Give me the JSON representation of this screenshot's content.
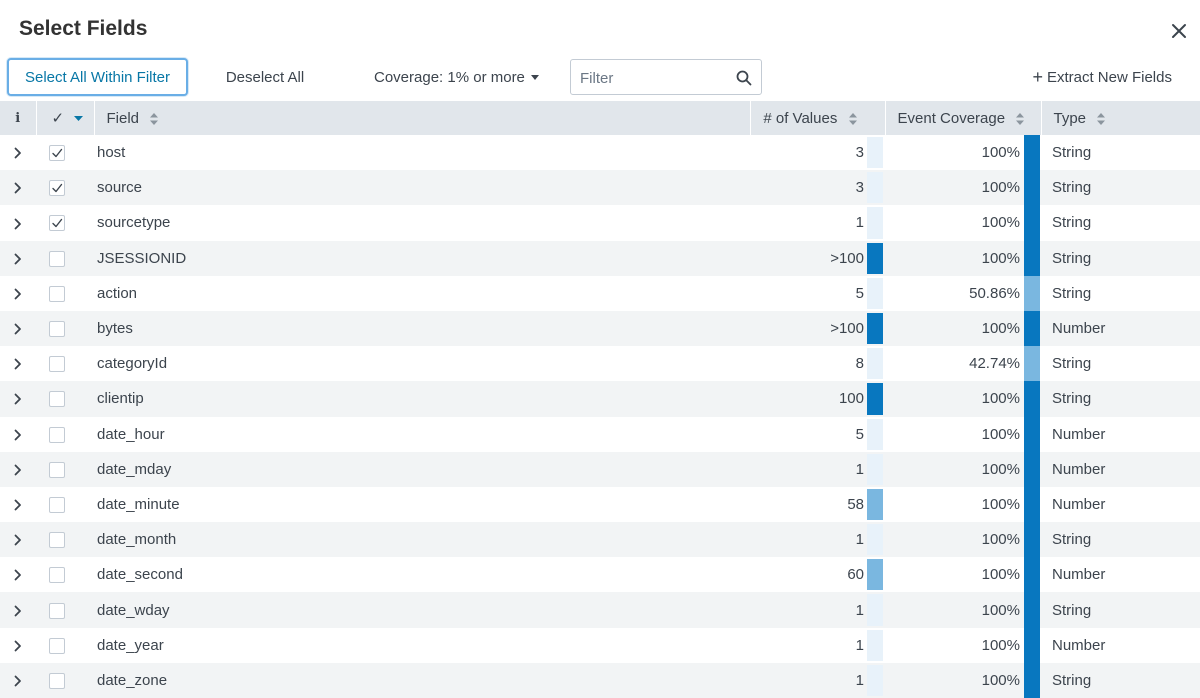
{
  "dialog": {
    "title": "Select Fields",
    "close_icon": "close-icon"
  },
  "toolbar": {
    "select_all_label": "Select All Within Filter",
    "deselect_all_label": "Deselect All",
    "coverage_label": "Coverage: 1% or more",
    "filter_placeholder": "Filter",
    "filter_value": "",
    "extract_label": "Extract New Fields"
  },
  "table": {
    "headers": {
      "info": "i",
      "check": "✓",
      "field": "Field",
      "values": "# of Values",
      "coverage": "Event Coverage",
      "type": "Type"
    },
    "rows": [
      {
        "checked": true,
        "field": "host",
        "values": "3",
        "values_fraction": 0.03,
        "coverage": "100%",
        "coverage_fraction": 1.0,
        "type": "String"
      },
      {
        "checked": true,
        "field": "source",
        "values": "3",
        "values_fraction": 0.03,
        "coverage": "100%",
        "coverage_fraction": 1.0,
        "type": "String"
      },
      {
        "checked": true,
        "field": "sourcetype",
        "values": "1",
        "values_fraction": 0.01,
        "coverage": "100%",
        "coverage_fraction": 1.0,
        "type": "String"
      },
      {
        "checked": false,
        "field": "JSESSIONID",
        "values": ">100",
        "values_fraction": 1.0,
        "coverage": "100%",
        "coverage_fraction": 1.0,
        "type": "String"
      },
      {
        "checked": false,
        "field": "action",
        "values": "5",
        "values_fraction": 0.05,
        "coverage": "50.86%",
        "coverage_fraction": 0.5086,
        "type": "String"
      },
      {
        "checked": false,
        "field": "bytes",
        "values": ">100",
        "values_fraction": 1.0,
        "coverage": "100%",
        "coverage_fraction": 1.0,
        "type": "Number"
      },
      {
        "checked": false,
        "field": "categoryId",
        "values": "8",
        "values_fraction": 0.08,
        "coverage": "42.74%",
        "coverage_fraction": 0.4274,
        "type": "String"
      },
      {
        "checked": false,
        "field": "clientip",
        "values": "100",
        "values_fraction": 1.0,
        "coverage": "100%",
        "coverage_fraction": 1.0,
        "type": "String"
      },
      {
        "checked": false,
        "field": "date_hour",
        "values": "5",
        "values_fraction": 0.05,
        "coverage": "100%",
        "coverage_fraction": 1.0,
        "type": "Number"
      },
      {
        "checked": false,
        "field": "date_mday",
        "values": "1",
        "values_fraction": 0.01,
        "coverage": "100%",
        "coverage_fraction": 1.0,
        "type": "Number"
      },
      {
        "checked": false,
        "field": "date_minute",
        "values": "58",
        "values_fraction": 0.58,
        "coverage": "100%",
        "coverage_fraction": 1.0,
        "type": "Number"
      },
      {
        "checked": false,
        "field": "date_month",
        "values": "1",
        "values_fraction": 0.01,
        "coverage": "100%",
        "coverage_fraction": 1.0,
        "type": "String"
      },
      {
        "checked": false,
        "field": "date_second",
        "values": "60",
        "values_fraction": 0.6,
        "coverage": "100%",
        "coverage_fraction": 1.0,
        "type": "Number"
      },
      {
        "checked": false,
        "field": "date_wday",
        "values": "1",
        "values_fraction": 0.01,
        "coverage": "100%",
        "coverage_fraction": 1.0,
        "type": "String"
      },
      {
        "checked": false,
        "field": "date_year",
        "values": "1",
        "values_fraction": 0.01,
        "coverage": "100%",
        "coverage_fraction": 1.0,
        "type": "Number"
      },
      {
        "checked": false,
        "field": "date_zone",
        "values": "1",
        "values_fraction": 0.01,
        "coverage": "100%",
        "coverage_fraction": 1.0,
        "type": "String"
      }
    ]
  },
  "colors": {
    "bar_full": "#0877bf",
    "bar_light": "#7ab7e0",
    "bar_faint": "#e8f2fa",
    "header_bg": "#e1e6eb",
    "accent": "#0877a6"
  }
}
